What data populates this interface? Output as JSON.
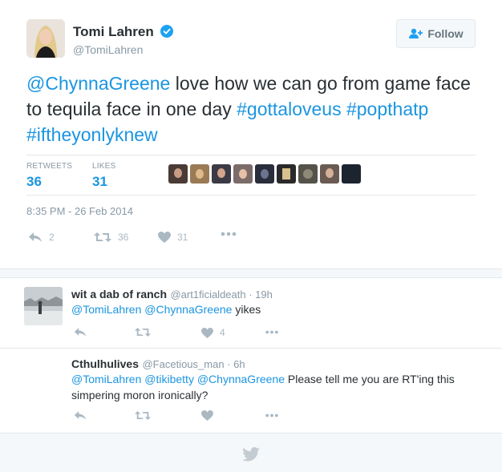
{
  "tweet": {
    "author_name": "Tomi Lahren",
    "author_handle": "@TomiLahren",
    "follow_label": "Follow",
    "text_parts": {
      "mention": "@ChynnaGreene",
      "body_1": " love how we can go from game face to tequila face in one day ",
      "tag1": "#gottaloveus",
      "tag2": "#popthatp",
      "tag3": "#iftheyonlyknew"
    },
    "retweets_label": "RETWEETS",
    "retweets_count": "36",
    "likes_label": "LIKES",
    "likes_count": "31",
    "timestamp": "8:35 PM - 26 Feb 2014",
    "actions": {
      "reply_count": "2",
      "retweet_count": "36",
      "like_count": "31"
    }
  },
  "replies": [
    {
      "name": "wit a dab of ranch",
      "meta": "@art1ficialdeath · 19h",
      "mention1": "@TomiLahren",
      "mention2": "@ChynnaGreene",
      "text": " yikes",
      "like_count": "4"
    },
    {
      "name": "Cthulhulives",
      "meta": "@Facetious_man · 6h",
      "mention1": "@TomiLahren",
      "mention2": "@tikibetty",
      "mention3": "@ChynnaGreene",
      "text": " Please tell me you are RT'ing this simpering moron ironically?"
    }
  ],
  "colors": {
    "link": "#1b95e0",
    "muted": "#8899a6",
    "icon": "#aab8c2"
  }
}
